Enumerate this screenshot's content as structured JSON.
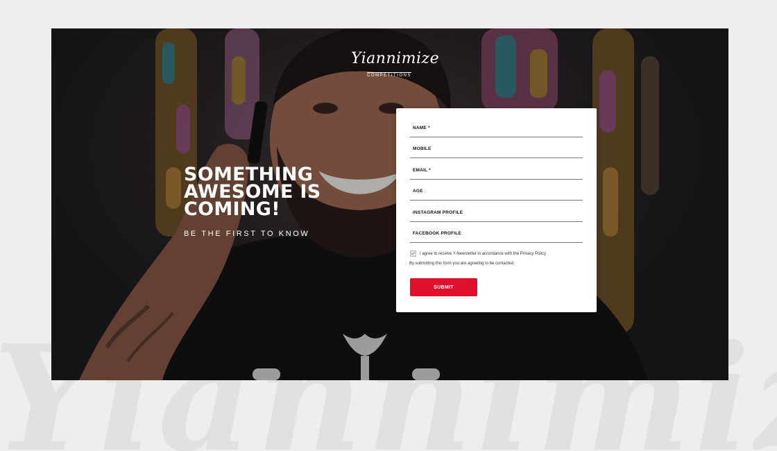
{
  "background": {
    "watermark_text": "Yiannimize"
  },
  "brand": {
    "name": "Yiannimize",
    "subtitle": "COMPETITIONS"
  },
  "hero": {
    "headline_lines": [
      "SOMETHING",
      "AWESOME IS",
      "COMING!"
    ],
    "tagline": "BE THE FIRST TO KNOW"
  },
  "form": {
    "fields": [
      {
        "label": "NAME *",
        "value": ""
      },
      {
        "label": "MOBILE",
        "value": ""
      },
      {
        "label": "EMAIL *",
        "value": ""
      },
      {
        "label": "AGE",
        "value": ""
      },
      {
        "label": "INSTAGRAM PROFILE",
        "value": ""
      },
      {
        "label": "FACEBOOK PROFILE",
        "value": ""
      }
    ],
    "consent_label": "I agree to receive Y-Newsletter in accordance with the Privacy Policy",
    "disclaimer": "By submitting this form you are agreeing to be contacted",
    "submit_label": "SUBMIT"
  },
  "colors": {
    "accent": "#e0102c",
    "hero_dark": "#1c1b1f",
    "page_bg": "#eeeeee"
  }
}
